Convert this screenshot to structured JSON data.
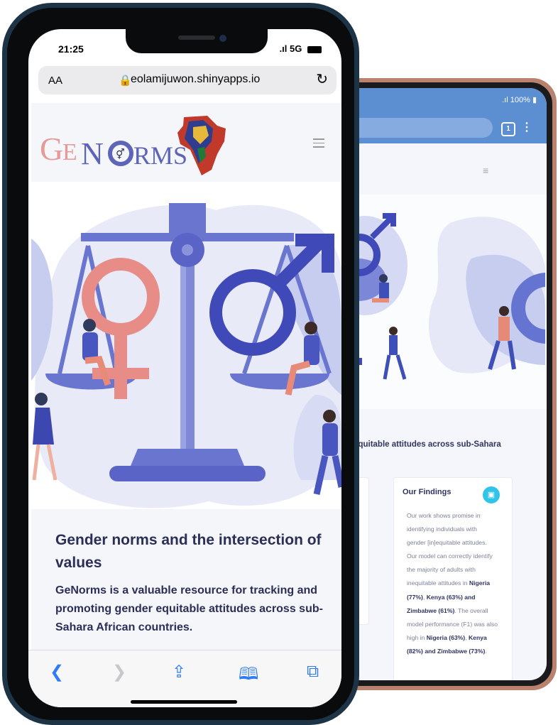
{
  "front": {
    "status": {
      "time": "21:25",
      "network": "5G"
    },
    "browser": {
      "text_size_label": "AA",
      "url": "eolamijuwon.shinyapps.io"
    },
    "site": {
      "logo_text": "GeNorms",
      "heading": "Gender norms and the intersection of values",
      "lead": "GeNorms is a valuable resource for tracking and promoting gender equitable attitudes across sub-Sahara African countries."
    }
  },
  "back": {
    "status": {
      "battery": "100%"
    },
    "browser": {
      "tab_count": "1"
    },
    "site": {
      "partial_heading": "er equitable attitudes across sub-Sahara",
      "findings_title": "Our Findings",
      "findings_intro": "Our work shows promise in identifying individuals with gender [in]equitable attitudes. Our model can correctly identify the majority of adults with inequitable attitudes in",
      "country1": "Nigeria (77%)",
      "country2": "Kenya (63%)",
      "and": "and",
      "country3": "Zimbabwe (61%)",
      "performance_intro": "The overall model performance (F1) was also high in",
      "perf1": "Nigeria (63%)",
      "perf2": "Kenya (82%)",
      "perf_and": "and",
      "perf3": "Zimbabwe (73%)"
    }
  },
  "colors": {
    "navy": "#2b2f57",
    "accent_blue": "#5b6ec7",
    "pink": "#e58a8a",
    "ios_blue": "#2f7cf6",
    "android_blue": "#5b8fd2"
  }
}
